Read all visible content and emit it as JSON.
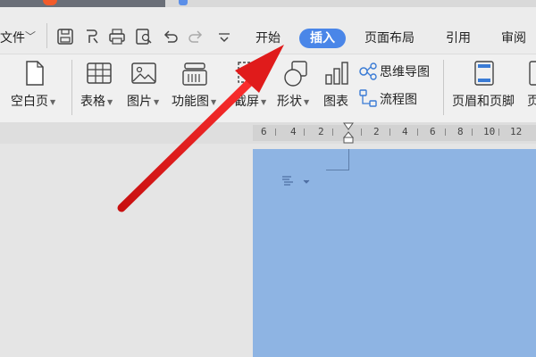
{
  "menu": {
    "file": "文件",
    "tabs": [
      "开始",
      "插入",
      "页面布局",
      "引用",
      "审阅"
    ],
    "active_tab": "插入"
  },
  "ribbon": {
    "blank_page": "空白页",
    "table": "表格",
    "picture": "图片",
    "function_chart": "功能图",
    "screenshot": "截屏",
    "shape": "形状",
    "chart": "图表",
    "mind_map": "思维导图",
    "flowchart": "流程图",
    "header_footer": "页眉和页脚",
    "next_cut": "页"
  },
  "ruler": {
    "ticks": [
      "6",
      "4",
      "2",
      "2",
      "4",
      "6",
      "8",
      "10",
      "12"
    ]
  },
  "colors": {
    "accent": "#4a86e8",
    "arrow": "#e01b1b",
    "page": "#8eb4e3"
  }
}
